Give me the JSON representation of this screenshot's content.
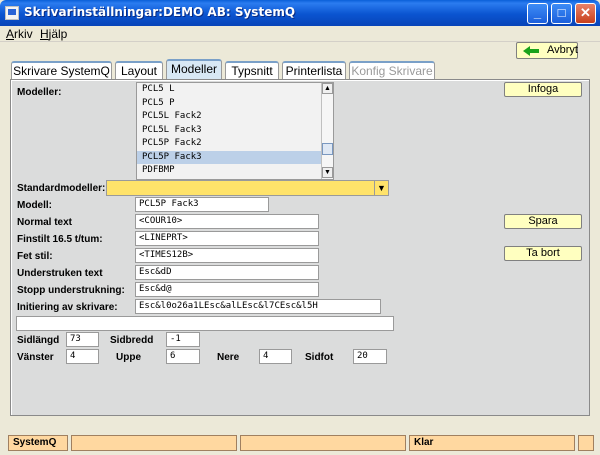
{
  "window": {
    "title": "Skrivarinställningar:DEMO AB: SystemQ",
    "minimize": "_",
    "maximize": "□",
    "close": "✕"
  },
  "menu": {
    "arkiv": "Arkiv",
    "hjalp": "Hjälp"
  },
  "toolbar": {
    "back_label": "Avbryt"
  },
  "tabs": [
    {
      "label": "Skrivare SystemQ",
      "active": false,
      "disabled": false
    },
    {
      "label": "Layout",
      "active": false,
      "disabled": false
    },
    {
      "label": "Modeller",
      "active": true,
      "disabled": false
    },
    {
      "label": "Typsnitt",
      "active": false,
      "disabled": false
    },
    {
      "label": "Printerlista",
      "active": false,
      "disabled": false
    },
    {
      "label": "Konfig Skrivare",
      "active": false,
      "disabled": true
    }
  ],
  "modeller": {
    "label": "Modeller:",
    "items": [
      "PCL5 L",
      "PCL5 P",
      "PCL5L Fack2",
      "PCL5L Fack3",
      "PCL5P Fack2",
      "PCL5P Fack3",
      "PDFBMP"
    ],
    "selected_index": 5,
    "scroll_up": "▲",
    "scroll_down": "▼"
  },
  "buttons": {
    "infoga": "Infoga",
    "spara": "Spara",
    "ta_bort": "Ta bort"
  },
  "standardmodeller": {
    "label": "Standardmodeller:",
    "value": "",
    "arrow": "▼"
  },
  "fields": {
    "modell": {
      "label": "Modell:",
      "value": "PCL5P Fack3"
    },
    "normal_text": {
      "label": "Normal text",
      "value": "<COUR10>"
    },
    "finstilt": {
      "label": "Finstilt 16.5 t/tum:",
      "value": "<LINEPRT>"
    },
    "fet_stil": {
      "label": "Fet stil:",
      "value": "<TIMES12B>"
    },
    "understruken": {
      "label": "Understruken text",
      "value": "Esc&dD"
    },
    "stopp": {
      "label": "Stopp understrukning:",
      "value": "Esc&d@"
    },
    "initiering": {
      "label": "Initiering av skrivare:",
      "value": "Esc&l0o26a1LEsc&alLEsc&l7CEsc&l5H"
    },
    "extra": {
      "value": ""
    }
  },
  "page_setup": {
    "sidlangd": {
      "label": "Sidlängd",
      "value": "73"
    },
    "sidbredd": {
      "label": "Sidbredd",
      "value": "-1"
    },
    "vanster": {
      "label": "Vänster",
      "value": "4"
    },
    "uppe": {
      "label": "Uppe",
      "value": "6"
    },
    "nere": {
      "label": "Nere",
      "value": "4"
    },
    "sidfot": {
      "label": "Sidfot",
      "value": "20"
    }
  },
  "status": {
    "app": "SystemQ",
    "seg2": "",
    "seg3": "",
    "state": "Klar",
    "seg5": ""
  },
  "colors": {
    "title_blue": "#0a54d0",
    "button_yellow": "#ffffc0",
    "combo_yellow": "#ffe36a",
    "status_orange": "#ffd8a0"
  }
}
